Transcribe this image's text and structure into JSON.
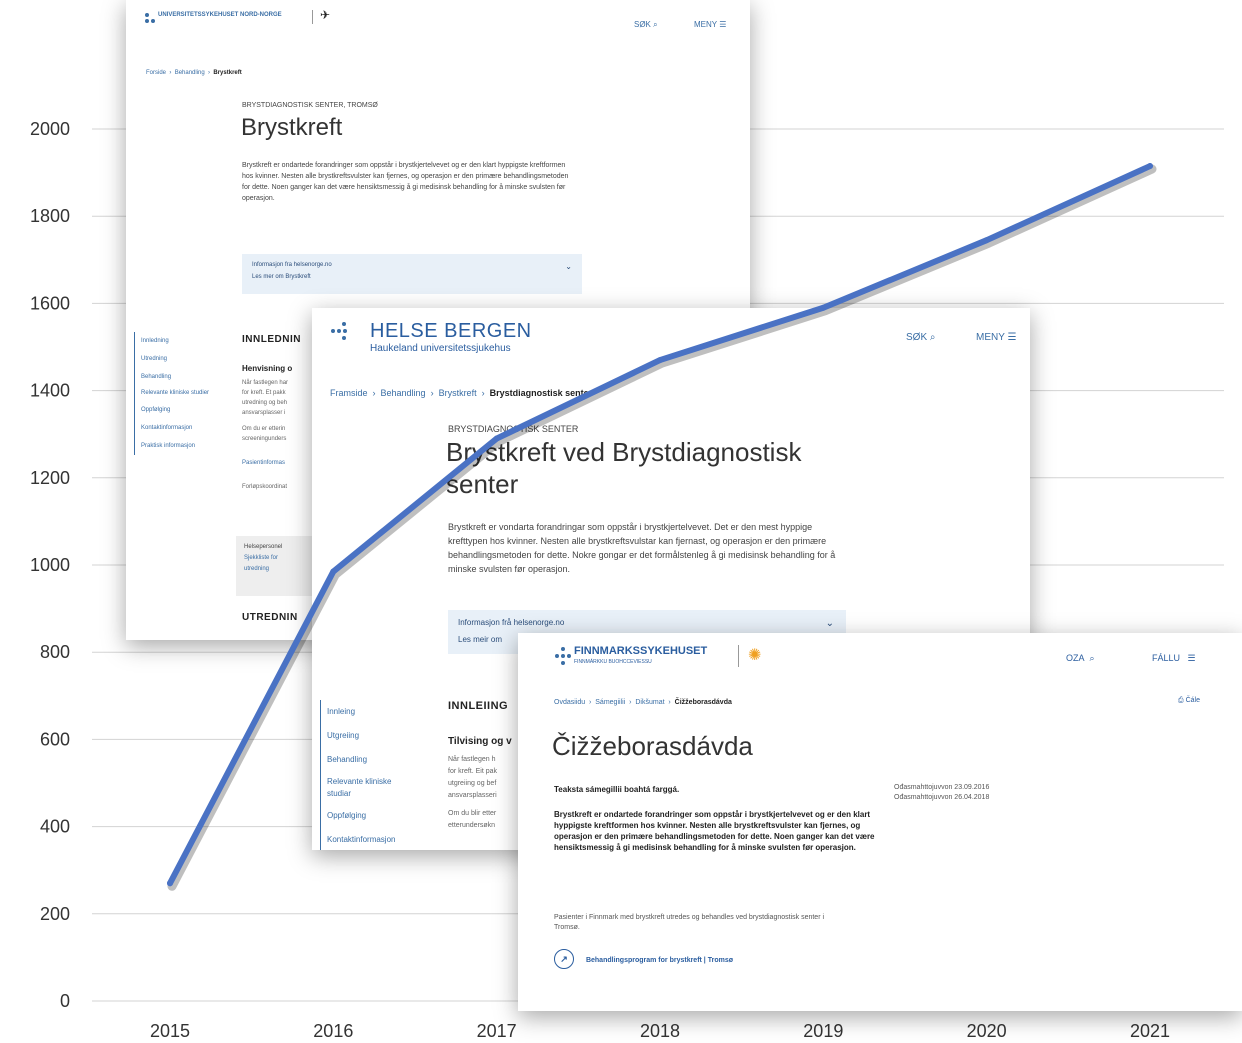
{
  "chart_data": {
    "type": "line",
    "x": [
      2015,
      2016,
      2017,
      2018,
      2019,
      2020,
      2021
    ],
    "series": [
      {
        "values": [
          270,
          985,
          1290,
          1470,
          1590,
          1745,
          1915
        ]
      }
    ],
    "xlim": [
      2015,
      2021
    ],
    "ylim": [
      0,
      2000
    ],
    "yticks": [
      0,
      200,
      400,
      600,
      800,
      1000,
      1200,
      1400,
      1600,
      1800,
      2000
    ],
    "xticks": [
      2015,
      2016,
      2017,
      2018,
      2019,
      2020,
      2021
    ],
    "line_color": "#4a72c4",
    "grid": true
  },
  "screenshot_unn": {
    "logo_text": "UNIVERSITETSSYKEHUSET NORD-NORGE",
    "search_label": "SØK",
    "menu_label": "MENY",
    "breadcrumb": [
      "Forside",
      "Behandling",
      "Brystkreft"
    ],
    "kicker": "BRYSTDIAGNOSTISK SENTER, TROMSØ",
    "title": "Brystkreft",
    "intro": "Brystkreft er ondartede forandringer som oppstår i brystkjertelvevet og er den klart hyppigste kreftformen hos kvinner. Nesten alle brystkreftsvulster kan fjernes, og operasjon er den primære behandlingsmetoden for dette. Noen ganger kan det være hensiktsmessig å gi medisinsk behandling for å minske svulsten før operasjon.",
    "info_box_title": "Informasjon fra helsenorge.no",
    "info_box_link": "Les mer om Brystkreft",
    "side_nav": [
      "Innledning",
      "Utredning",
      "Behandling",
      "Relevante kliniske studier",
      "Oppfølging",
      "Kontaktinformasjon",
      "Praktisk informasjon"
    ],
    "section_1": "INNLEDNIN",
    "sub_1": "Henvisning o",
    "section_2": "UTREDNIN",
    "text_1": "Når fastlegen har",
    "text_2": "for kreft. Et pakk",
    "text_3": "utredning og beh",
    "text_4": "ansvarsplasser i",
    "text_5": "Om du er etterin",
    "text_6": "screeningunders",
    "link_1": "Pasientinformas",
    "text_7": "Forløpskoordinat",
    "grey_1": "Helsepersonel",
    "grey_2": "Sjekkliste for",
    "grey_3": "utredning"
  },
  "screenshot_bergen": {
    "logo_title": "HELSE BERGEN",
    "logo_subtitle": "Haukeland universitetssjukehus",
    "search_label": "SØK",
    "menu_label": "MENY",
    "breadcrumb": [
      "Framside",
      "Behandling",
      "Brystkreft",
      "Brystdiagnostisk senter"
    ],
    "kicker": "BRYSTDIAGNOSTISK SENTER",
    "title": "Brystkreft ved Brystdiagnostisk senter",
    "intro": "Brystkreft er vondarta forandringar som oppstår i brystkjertelvevet. Det er den mest hyppige krefttypen hos kvinner. Nesten alle brystkreftsvulstar kan fjernast, og operasjon er den primære behandlingsmetoden for dette. Nokre gongar er det formålstenleg å gi medisinsk behandling for å minske svulsten før operasjon.",
    "info_box_title": "Informasjon frå helsenorge.no",
    "info_box_link": "Les meir om",
    "side_nav": [
      "Innleing",
      "Utgreiing",
      "Behandling",
      "Relevante kliniske studiar",
      "Oppfølging",
      "Kontaktinformasjon"
    ],
    "section_1": "INNLEIING",
    "sub_1": "Tilvising og v",
    "text_1": "Når fastlegen h",
    "text_2": "for kreft. Eit pak",
    "text_3": "utgreiing og bef",
    "text_4": "ansvarsplasseri",
    "text_5": "Om du blir etter",
    "text_6": "etterundersøkn"
  },
  "screenshot_finnmark": {
    "logo_title": "FINNMARKSSYKEHUSET",
    "logo_subtitle": "FINNMÁRKKU BUOHCCEVIESSU",
    "search_label": "OZA",
    "menu_label": "FÁLLU",
    "breadcrumb": [
      "Ovdasiidu",
      "Sámegiilii",
      "Dikšumat",
      "Čižžeborasdávda"
    ],
    "print_label": "Čále",
    "title": "Čižžeborasdávda",
    "lead": "Teaksta sámegillii boahtá farggá.",
    "dates_1": "Ođasmahttojuvvon 23.09.2016",
    "dates_2": "Ođasmahttojuvvon 26.04.2018",
    "body": "Brystkreft er ondartede forandringer som oppstår i brystkjertelvevet og er den klart hyppigste kreftformen hos kvinner. Nesten alle brystkreftsvulster kan fjernes, og operasjon er den primære behandlingsmetoden for dette. Noen ganger kan det være hensiktsmessig å gi medisinsk behandling for å minske svulsten før operasjon.",
    "note": "Pasienter i Finnmark med brystkreft utredes og behandles ved brystdiagnostisk senter i Tromsø.",
    "link": "Behandlingsprogram for brystkreft | Tromsø"
  }
}
